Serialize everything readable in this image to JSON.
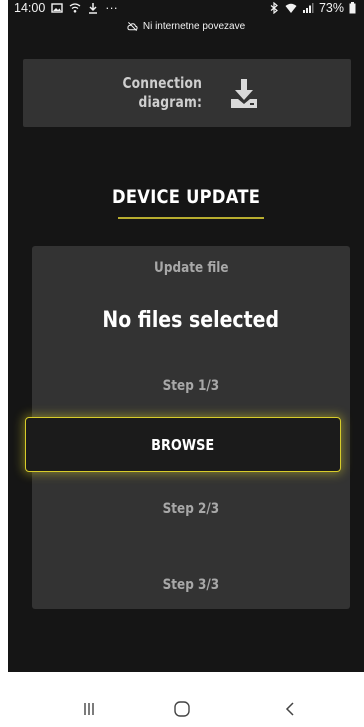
{
  "status_bar": {
    "time": "14:00",
    "more": "···",
    "battery": "73%"
  },
  "network": {
    "message": "Ni internetne povezave"
  },
  "connection": {
    "label": "Connection\ndiagram:",
    "icon": "download-icon"
  },
  "title": "DEVICE UPDATE",
  "update_panel": {
    "heading": "Update file",
    "file_status": "No files selected",
    "step1": "Step 1/3",
    "browse_label": "BROWSE",
    "step2": "Step 2/3",
    "step3": "Step 3/3"
  },
  "nav": {
    "recents_icon": "recents-icon",
    "home_icon": "home-icon",
    "back_icon": "back-icon"
  },
  "colors": {
    "background": "#151515",
    "panel": "#333333",
    "accent": "#d8cc2a"
  }
}
